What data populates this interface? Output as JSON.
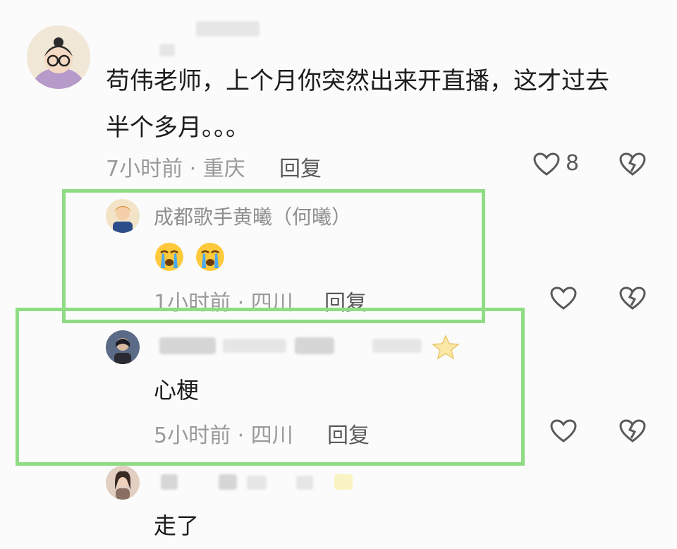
{
  "comments": [
    {
      "text_line1": "苟伟老师，上个月你突然出来开直播，这才过去",
      "text_line2": "半个多月。。。",
      "time": "7小时前",
      "location": "重庆",
      "reply_label": "回复",
      "likes": "8"
    }
  ],
  "replies": [
    {
      "author": "成都歌手黄曦（何曦）",
      "time": "1小时前",
      "location": "四川",
      "reply_label": "回复"
    },
    {
      "text": "心梗",
      "time": "5小时前",
      "location": "四川",
      "reply_label": "回复"
    },
    {
      "text": "走了"
    }
  ],
  "meta_separator": "·",
  "colors": {
    "highlight_border": "#8fdc84",
    "meta_text": "#9a9a9a"
  },
  "icons": [
    "heart-outline-icon",
    "broken-heart-icon",
    "crying-emoji-icon",
    "star-icon"
  ]
}
